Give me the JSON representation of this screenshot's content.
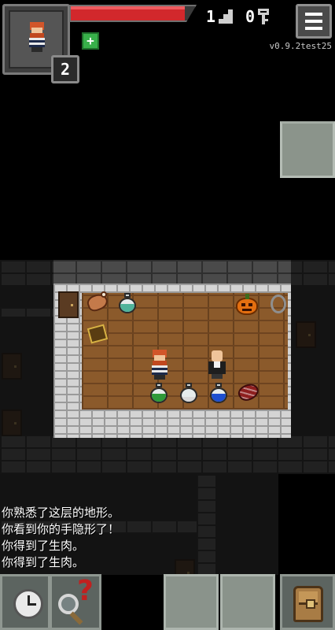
{
  "hud": {
    "hero_level": "2",
    "hp_fraction": 0.92,
    "buff_icon": "plus-icon",
    "depth": "1",
    "keys": "0",
    "menu_icon": "hamburger-menu-icon",
    "version": "v0.9.2test25"
  },
  "log": {
    "lines": [
      "你熟悉了这层的地形。",
      "你看到你的手隐形了！",
      "你得到了生肉。",
      "你得到了生肉。"
    ]
  },
  "toolbar": {
    "wait_icon": "clock-icon",
    "search_icon": "magnifier-question-icon",
    "backpack_icon": "backpack-icon"
  },
  "colors": {
    "hp": "#d2282c",
    "buff": "#38b04a",
    "wood_floor": "#8b5a2b",
    "lit_wall": "#d4d4d4"
  }
}
